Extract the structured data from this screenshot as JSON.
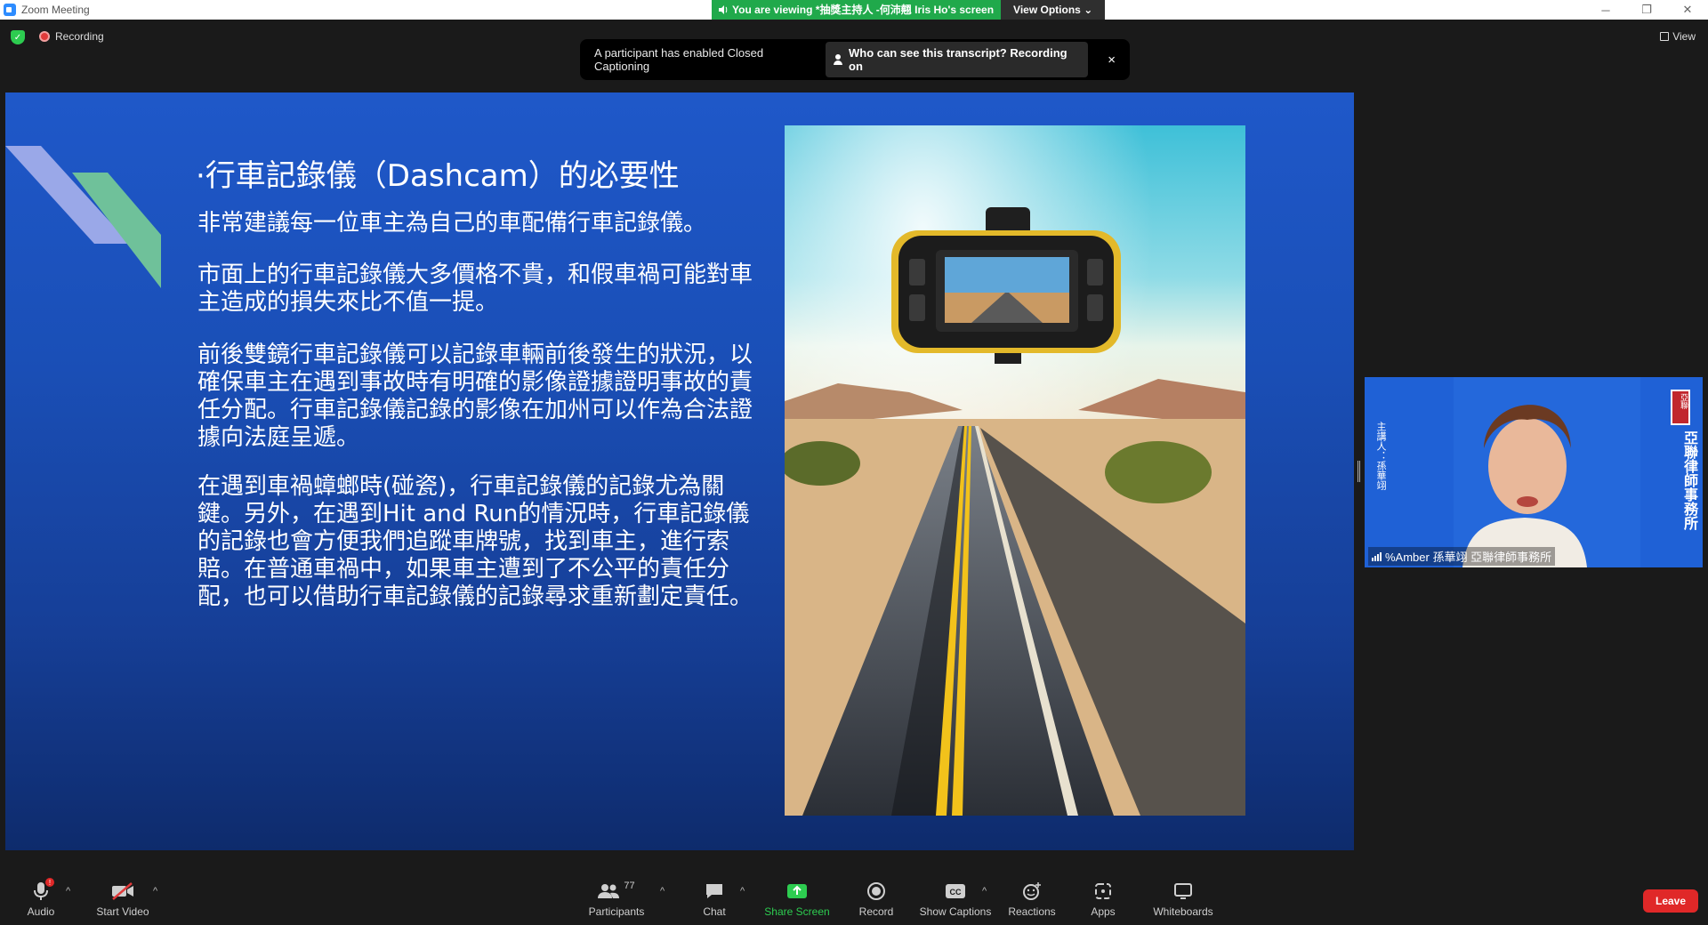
{
  "window": {
    "title": "Zoom Meeting",
    "viewing_banner": "You are viewing *抽獎主持人 -何沛翹 Iris Ho's screen",
    "view_options": "View Options"
  },
  "topbar": {
    "recording": "Recording",
    "view": "View"
  },
  "cc_banner": {
    "message": "A participant has enabled Closed Captioning",
    "who": "Who can see this transcript? Recording on",
    "close": "×"
  },
  "slide": {
    "title": "·行車記錄儀（Dashcam）的必要性",
    "paragraphs": [
      "非常建議每一位車主為自己的車配備行車記錄儀。",
      "市面上的行車記錄儀大多價格不貴，和假車禍可能對車主造成的損失來比不值一提。",
      "前後雙鏡行車記錄儀可以記錄車輛前後發生的狀況，以確保車主在遇到事故時有明確的影像證據證明事故的責任分配。行車記錄儀記錄的影像在加州可以作為合法證據向法庭呈遞。",
      "在遇到車禍蟑螂時(碰瓷)，行車記錄儀的記錄尤為關鍵。另外，在遇到Hit and Run的情況時，行車記錄儀的記錄也會方便我們追蹤車牌號，找到車主，進行索賠。在普通車禍中，如果車主遭到了不公平的責任分配，也可以借助行車記錄儀的記錄尋求重新劃定責任。"
    ]
  },
  "video": {
    "name": "%Amber 孫華翊 亞聯律師事務所",
    "left_text": "主講人：孫華翊",
    "right_text": "亞聯律師事務所",
    "stamp": "亞聯"
  },
  "toolbar": {
    "audio": "Audio",
    "start_video": "Start Video",
    "participants": "Participants",
    "participants_count": "77",
    "chat": "Chat",
    "share_screen": "Share Screen",
    "record": "Record",
    "show_captions": "Show Captions",
    "reactions": "Reactions",
    "apps": "Apps",
    "whiteboards": "Whiteboards",
    "leave": "Leave",
    "audio_badge": "!"
  },
  "colors": {
    "zoom_blue": "#2d8cff",
    "share_green": "#2dcc50",
    "leave_red": "#e02828",
    "banner_green": "#20a94b"
  }
}
